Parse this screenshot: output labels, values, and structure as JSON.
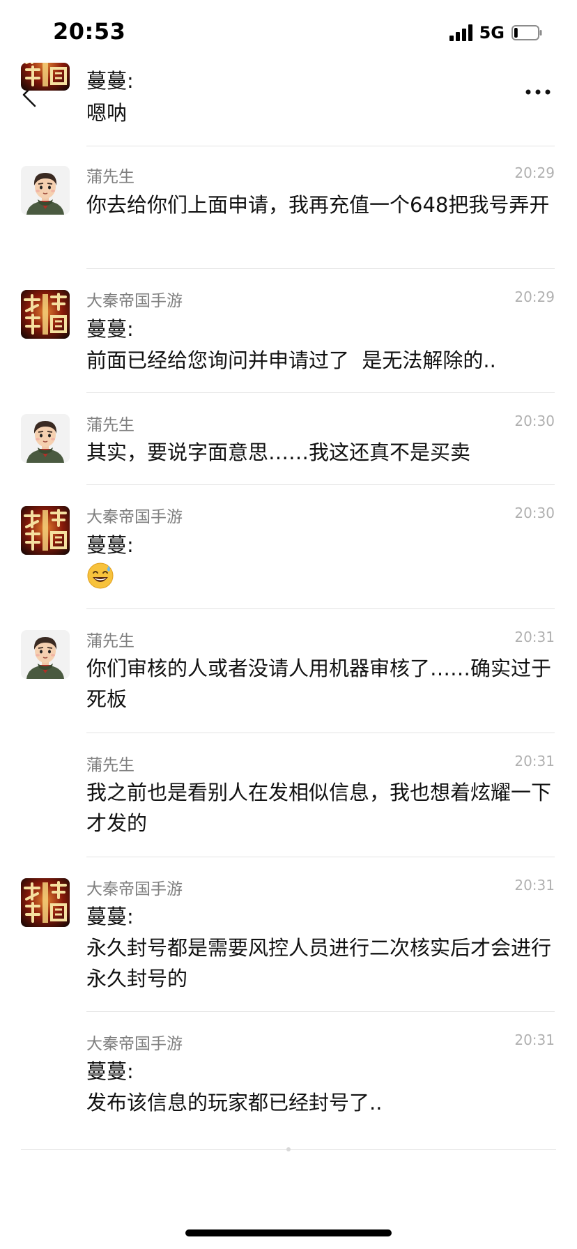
{
  "status_bar": {
    "time": "20:53",
    "network": "5G",
    "battery_level": 0.15
  },
  "colors": {
    "sender_gray": "#808080",
    "time_gray": "#b0b0b0",
    "divider": "#e2e2e2",
    "game_avatar_red": "#8a1a0a",
    "game_avatar_gold": "#f0c060"
  },
  "icons": {
    "back": "chevron-left-icon",
    "more": "ellipsis-icon",
    "user_avatar": "cartoon-man-avatar",
    "game_avatar": "game-logo-avatar",
    "emoji": "grinning-sweat-emoji"
  },
  "messages": [
    {
      "sender": "",
      "avatar": "game",
      "time": "",
      "prefix": "蔓蔓:",
      "text": "嗯呐"
    },
    {
      "sender": "蒲先生",
      "avatar": "user",
      "time": "20:29",
      "prefix": "",
      "text": "你去给你们上面申请，我再充值一个648把我号弄开"
    },
    {
      "sender": "大秦帝国手游",
      "avatar": "game",
      "time": "20:29",
      "prefix": "蔓蔓:",
      "text": "前面已经给您询问并申请过了  是无法解除的.."
    },
    {
      "sender": "蒲先生",
      "avatar": "user",
      "time": "20:30",
      "prefix": "",
      "text": "其实，要说字面意思……我这还真不是买卖"
    },
    {
      "sender": "大秦帝国手游",
      "avatar": "game",
      "time": "20:30",
      "prefix": "蔓蔓:",
      "text": "😅"
    },
    {
      "sender": "蒲先生",
      "avatar": "user",
      "time": "20:31",
      "prefix": "",
      "text": "你们审核的人或者没请人用机器审核了……确实过于死板"
    },
    {
      "sender": "蒲先生",
      "avatar": "none",
      "time": "20:31",
      "prefix": "",
      "text": "我之前也是看别人在发相似信息，我也想着炫耀一下才发的"
    },
    {
      "sender": "大秦帝国手游",
      "avatar": "game",
      "time": "20:31",
      "prefix": "蔓蔓:",
      "text": "永久封号都是需要风控人员进行二次核实后才会进行永久封号的"
    },
    {
      "sender": "大秦帝国手游",
      "avatar": "none",
      "time": "20:31",
      "prefix": "蔓蔓:",
      "text": "发布该信息的玩家都已经封号了.."
    }
  ]
}
